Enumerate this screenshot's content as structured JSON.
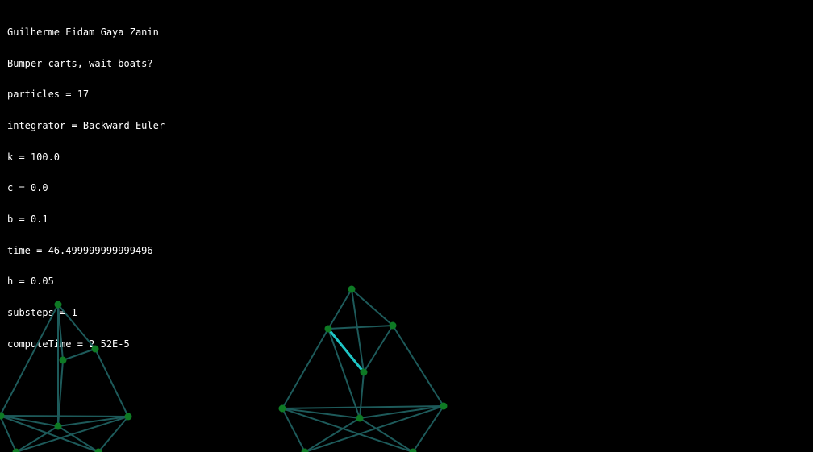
{
  "hud": {
    "author": "Guilherme Eidam Gaya Zanin",
    "subtitle": "Bumper carts, wait boats?",
    "particles": "particles = 17",
    "integrator": "integrator = Backward Euler",
    "k": "k = 100.0",
    "c": "c = 0.0",
    "b": "b = 0.1",
    "time": "time = 46.499999999999496",
    "h": "h = 0.05",
    "substeps": "substeps = 1",
    "computeTime": "computeTime = 2.52E-5"
  },
  "colors": {
    "background": "#000000",
    "text": "#ffffff",
    "spring": "#1d5a5a",
    "spring_highlight": "#1fc6c6",
    "particle": "#0e7a24"
  }
}
